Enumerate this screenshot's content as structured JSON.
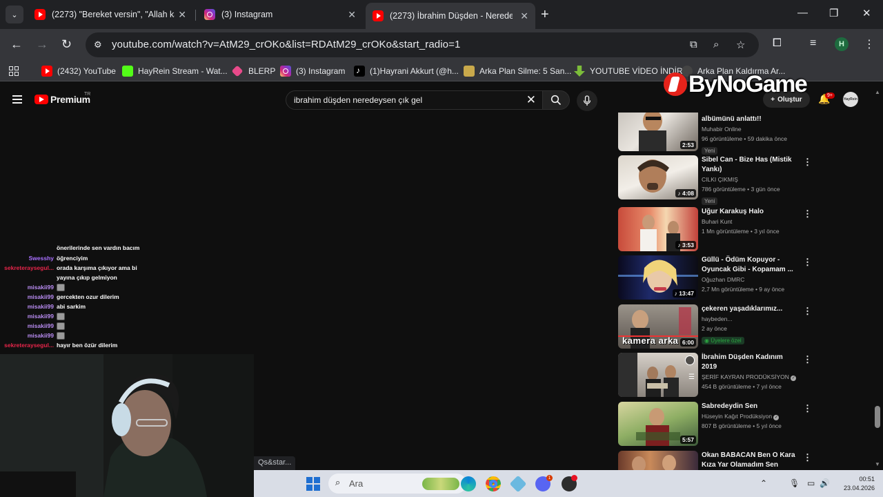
{
  "browser": {
    "tabs": [
      {
        "title": "(2273) \"Bereket versin\", \"Allah kaz",
        "icon": "youtube-icon",
        "active": false
      },
      {
        "title": "(3) Instagram",
        "icon": "instagram-icon",
        "active": false
      },
      {
        "title": "(2273) İbrahim Düşden - Neredeys",
        "icon": "youtube-icon",
        "active": true
      }
    ],
    "url": "youtube.com/watch?v=AtM29_crOKo&list=RDAtM29_crOKo&start_radio=1",
    "profile_initial": "H",
    "bookmarks": [
      {
        "label": "(2432) YouTube",
        "icon": "youtube-icon"
      },
      {
        "label": "HayRein Stream - Wat...",
        "icon": "kick-icon"
      },
      {
        "label": "BLERP",
        "icon": "blerp-icon"
      },
      {
        "label": "(3) Instagram",
        "icon": "instagram-icon"
      },
      {
        "label": "(1)Hayrani Akkurt (@h...",
        "icon": "tiktok-icon"
      },
      {
        "label": "Arka Plan Silme: 5 San...",
        "icon": "arka-plan-icon"
      },
      {
        "label": "YOUTUBE VİDEO İNDİR",
        "icon": "download-icon"
      },
      {
        "label": "Arka Plan Kaldırma Ar...",
        "icon": "remove-bg-icon"
      }
    ],
    "status_url": "Qs&star..."
  },
  "watermark": {
    "text": "ByNoGame"
  },
  "youtube": {
    "brand": "Premium",
    "region": "TR",
    "search_query": "ibrahim düşden neredeysen çık gel",
    "create_label": "Oluştur",
    "notification_count": "9+",
    "avatar_label": "HayRein",
    "related": [
      {
        "title_lines": [
          "albümünü anlattı!!"
        ],
        "channel": "Muhabir Online",
        "views": "96 görüntüleme • 59 dakika önce",
        "badge": "Yeni",
        "duration": "2:53",
        "mix": false
      },
      {
        "title_lines": [
          "Sibel Can - Bize Has (Mistik",
          "Yankı)"
        ],
        "channel": "CILKI ÇIKMIŞ",
        "views": "786 görüntüleme • 3 gün önce",
        "badge": "Yeni",
        "duration": "4:08",
        "mix": true
      },
      {
        "title_lines": [
          "Uğur Karakuş Halo"
        ],
        "channel": "Buhari Kunt",
        "views": "1 Mn görüntüleme • 3 yıl önce",
        "badge": "",
        "duration": "3:53",
        "mix": true
      },
      {
        "title_lines": [
          "Güllü - Ödüm Kopuyor -",
          "Oyuncak Gibi - Kopamam ..."
        ],
        "channel": "Oğuzhan DMRC",
        "views": "2,7 Mn görüntüleme • 9 ay önce",
        "badge": "",
        "duration": "13:47",
        "mix": true
      },
      {
        "title_lines": [
          "çekeren yaşadıklarımız..."
        ],
        "channel": "haybeden...",
        "views": "2 ay önce",
        "badge": "Üyelere özel",
        "duration": "6:00",
        "mix": false,
        "thumb_text": "kamera arka"
      },
      {
        "title_lines": [
          "İbrahim Düşden  Kadınım 2019"
        ],
        "channel": "ŞERİF KAYRAN PRODÜKSİYON",
        "views": "454 B görüntüleme • 7 yıl önce",
        "badge": "",
        "duration": "",
        "mix": false,
        "verified": true
      },
      {
        "title_lines": [
          "Sabredeydin Sen"
        ],
        "channel": "Hüseyin Kağıt Prodüksiyon",
        "views": "807 B görüntüleme • 5 yıl önce",
        "badge": "",
        "duration": "5:57",
        "mix": false,
        "verified": true
      },
      {
        "title_lines": [
          "Okan BABACAN   Ben O Kara",
          "Kıza Yar Olamadım   Sen Rüzg..."
        ],
        "channel": "",
        "views": "",
        "badge": "",
        "duration": "",
        "mix": false
      }
    ]
  },
  "chat": [
    {
      "user": "",
      "message": "önerilerinde sen vardın bacım",
      "color": "#ffffff"
    },
    {
      "user": "Swesshy",
      "message": "öğrenciyim",
      "color": "#a970ff"
    },
    {
      "user": "sekreteraysegul...",
      "message": "orada karşıma çıkıyor ama bi",
      "color": "#e8254a"
    },
    {
      "user": "",
      "message": "yayına çıkıp gelmiyon",
      "color": "#ffffff"
    },
    {
      "user": "misakii99",
      "message": "",
      "color": "#b98cf2",
      "emote": true
    },
    {
      "user": "misakii99",
      "message": "gercekten ozur dilerim",
      "color": "#b98cf2"
    },
    {
      "user": "misakii99",
      "message": "abi sarkim",
      "color": "#b98cf2"
    },
    {
      "user": "misakii99",
      "message": "",
      "color": "#b98cf2",
      "emote": true
    },
    {
      "user": "misakii99",
      "message": "",
      "color": "#b98cf2",
      "emote": true
    },
    {
      "user": "misakii99",
      "message": "",
      "color": "#b98cf2",
      "emote": true
    },
    {
      "user": "sekreteraysegul...",
      "message": "hayır ben özür dilerim",
      "color": "#e8254a"
    }
  ],
  "taskbar": {
    "search_placeholder": "Ara",
    "time": "00:51",
    "date": "23.04.2026",
    "discord_badge": "1"
  }
}
